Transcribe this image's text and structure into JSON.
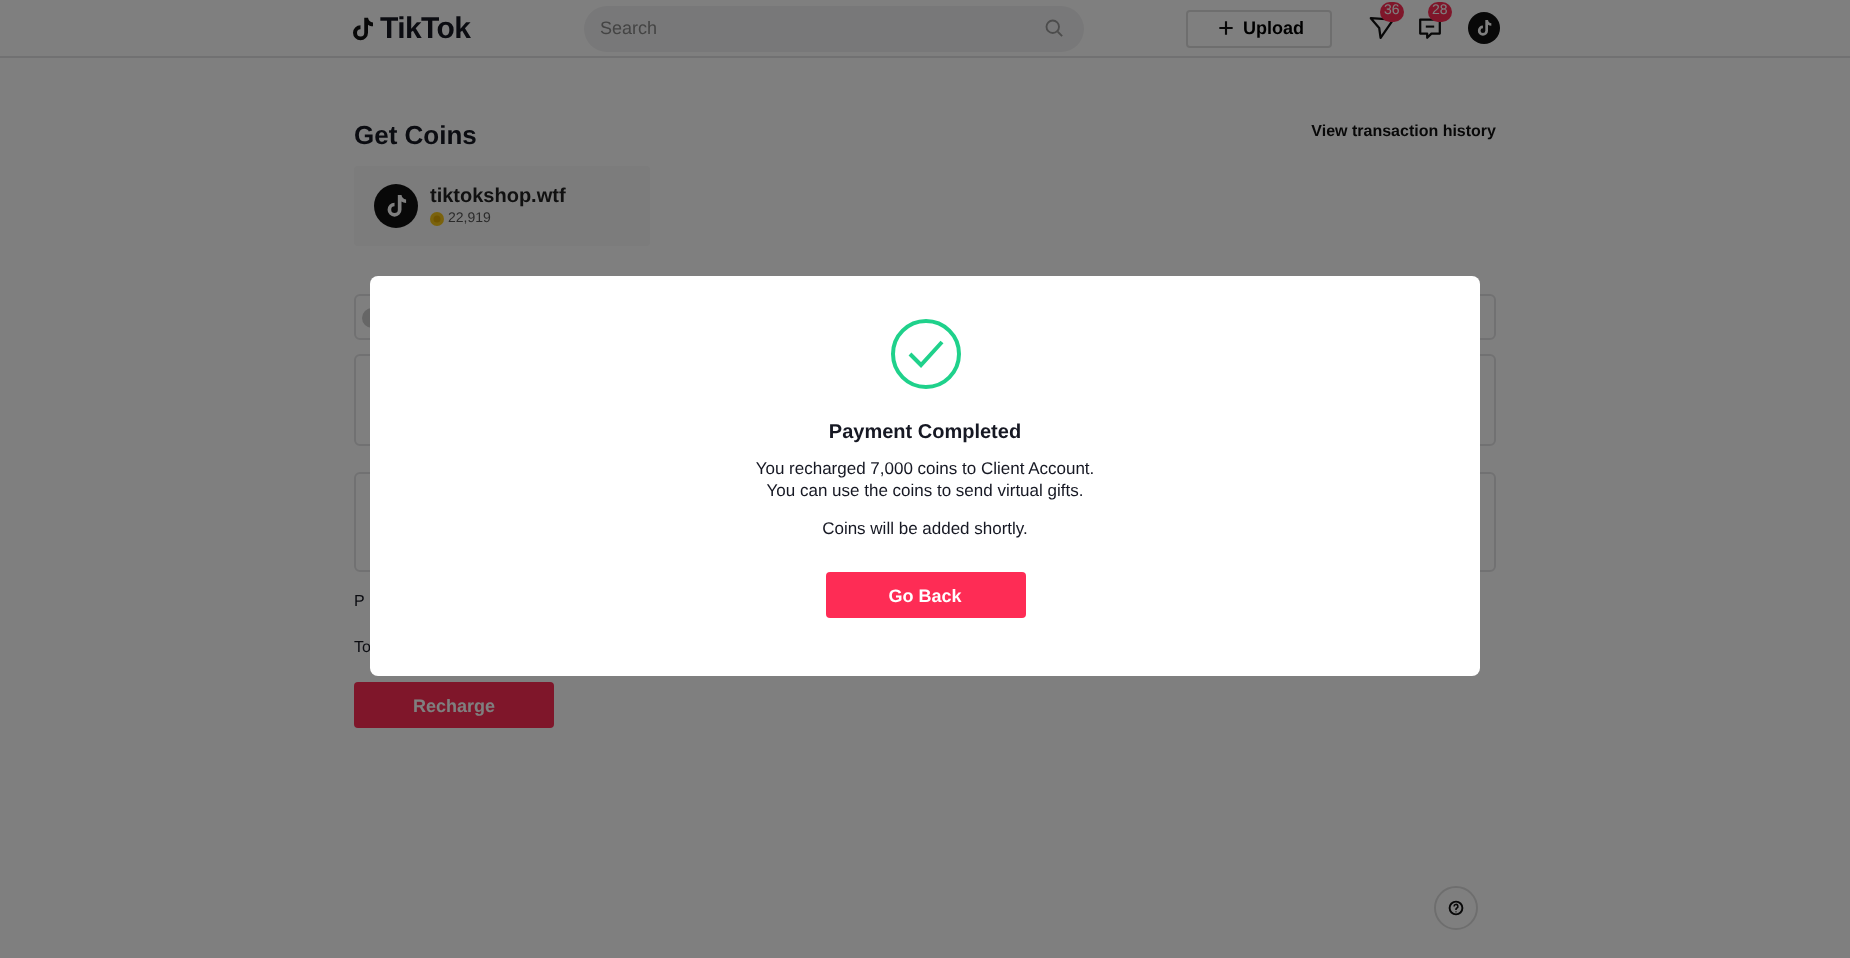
{
  "header": {
    "logo": "TikTok",
    "search": {
      "placeholder": "Search"
    },
    "upload": "Upload",
    "inbox_badge": "36",
    "messages_badge": "28"
  },
  "page": {
    "title": "Get Coins",
    "history_link": "View transaction history",
    "account": {
      "name": "tiktokshop.wtf",
      "coins": "22,919"
    },
    "fragments": [
      "P",
      "To"
    ],
    "recharge": "Recharge"
  },
  "modal": {
    "title": "Payment Completed",
    "lines": [
      "You recharged 7,000 coins to Client Account.",
      "You can use the coins to send virtual gifts."
    ],
    "note": "Coins will be added shortly.",
    "button": "Go Back"
  }
}
